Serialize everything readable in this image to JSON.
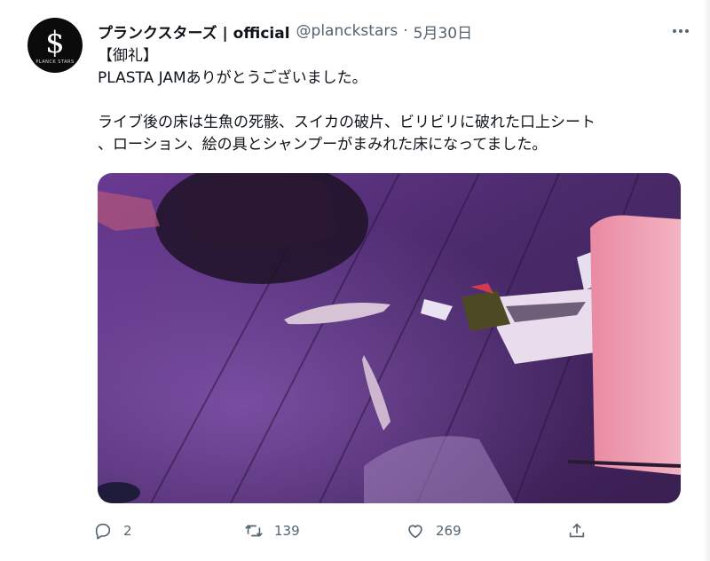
{
  "account": {
    "name": "プランクスターズ | official",
    "handle": "@planckstars",
    "separator": "·",
    "date": "5月30日",
    "avatar_glyph": "$",
    "avatar_subtext": "PLANCK STARS"
  },
  "tweet": {
    "line1": "【御礼】",
    "line2": "PLASTA JAMありがとうございました。",
    "line3": "ライブ後の床は生魚の死骸、スイカの破片、ビリビリに破れた口上シート",
    "line4": "、ローション、絵の具とシャンプーがまみれた床になってました。"
  },
  "media": {
    "description_icon": "photo-of-stage-floor",
    "tint": "#7a3fa8"
  },
  "actions": {
    "reply_count": "2",
    "retweet_count": "139",
    "like_count": "269"
  },
  "icons": {
    "more": "more-horizontal-icon",
    "reply": "reply-icon",
    "retweet": "retweet-icon",
    "like": "heart-icon",
    "share": "share-icon"
  },
  "colors": {
    "text": "#0f1419",
    "muted": "#536471",
    "avatar_bg": "#0b0b0b"
  }
}
